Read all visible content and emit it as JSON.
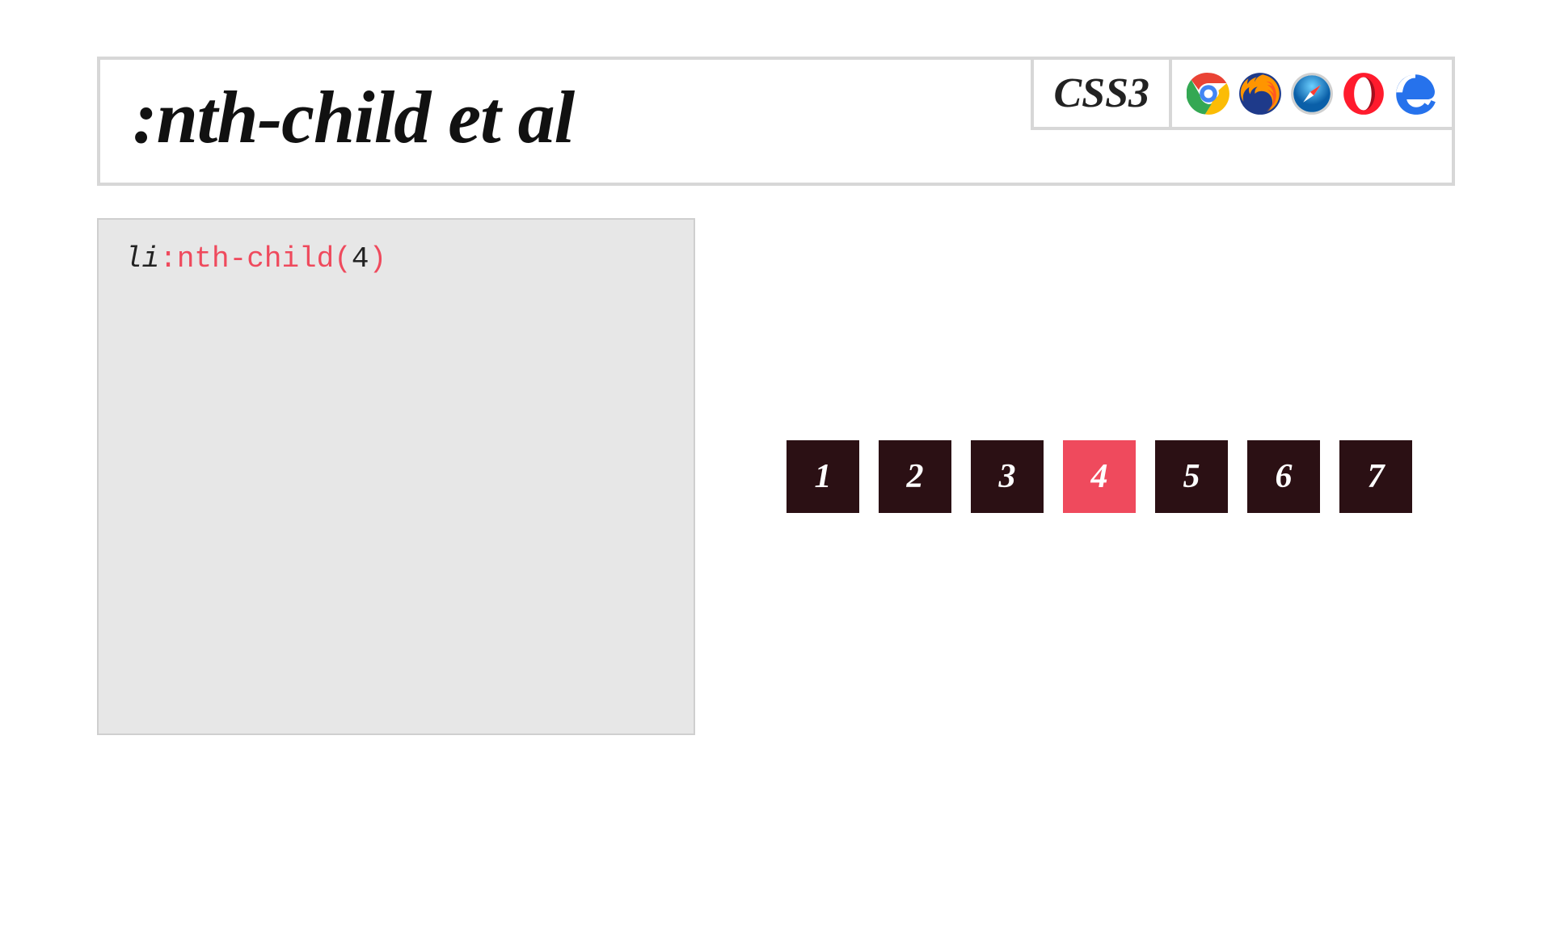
{
  "header": {
    "title": ":nth-child et al",
    "spec": "CSS3",
    "browsers": [
      "chrome",
      "firefox",
      "safari",
      "opera",
      "edge"
    ]
  },
  "code": {
    "element": "li",
    "selector_open": ":nth-child(",
    "arg": "4",
    "selector_close": ")"
  },
  "demo": {
    "items": [
      "1",
      "2",
      "3",
      "4",
      "5",
      "6",
      "7"
    ],
    "selected_index": 3
  },
  "colors": {
    "accent": "#ef4a5d",
    "box_dark": "#2b1014",
    "panel_bg": "#e7e7e7",
    "border": "#d7d7d7"
  }
}
